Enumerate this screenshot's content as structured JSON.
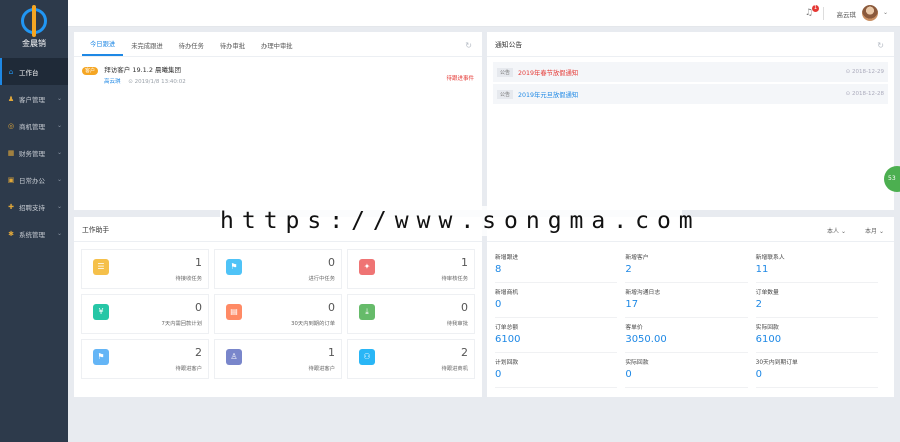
{
  "brand": {
    "name": "金晨销"
  },
  "sidebar": {
    "items": [
      {
        "label": "工作台",
        "active": true,
        "icon": "home-icon"
      },
      {
        "label": "客户管理",
        "icon": "users-icon"
      },
      {
        "label": "商机管理",
        "icon": "bulb-icon"
      },
      {
        "label": "财务管理",
        "icon": "finance-icon"
      },
      {
        "label": "日常办公",
        "icon": "briefcase-icon"
      },
      {
        "label": "招聘支持",
        "icon": "recruit-icon"
      },
      {
        "label": "系统管理",
        "icon": "gear-icon"
      }
    ]
  },
  "topbar": {
    "badge": "1",
    "username": "高云琪"
  },
  "tasks": {
    "tabs": [
      "今日跟进",
      "未完成跟进",
      "待办任务",
      "待办审批",
      "办理中审批"
    ],
    "item": {
      "tag": "客户",
      "title": "拜访客户 19.1.2 晨曦集团",
      "user": "高云琪",
      "time": "⊙ 2019/1/8 13:40:02",
      "status": "待跟进事件"
    }
  },
  "notices": {
    "title": "通知公告",
    "items": [
      {
        "tag": "公告",
        "title": "2019年春节放假通知",
        "date": "⊙ 2018-12-29",
        "color": "#e53935"
      },
      {
        "tag": "公告",
        "title": "2019年元旦放假通知",
        "date": "⊙ 2018-12-28",
        "color": "#1e88e5"
      }
    ]
  },
  "helper": {
    "title": "工作助手",
    "cards": [
      {
        "num": "1",
        "label": "待接收任务",
        "icon": "list-icon",
        "color": "#f5c04a",
        "glyph": "☰"
      },
      {
        "num": "0",
        "label": "进行中任务",
        "icon": "flag-icon",
        "color": "#4fc3f7",
        "glyph": "⚑"
      },
      {
        "num": "1",
        "label": "待审核任务",
        "icon": "pin-icon",
        "color": "#ef7474",
        "glyph": "✦"
      },
      {
        "num": "0",
        "label": "7天内需回款计划",
        "icon": "yen-icon",
        "color": "#26c6a6",
        "glyph": "¥"
      },
      {
        "num": "0",
        "label": "30天内到期的订单",
        "icon": "document-icon",
        "color": "#ff8a65",
        "glyph": "▤"
      },
      {
        "num": "0",
        "label": "待我审批",
        "icon": "approve-icon",
        "color": "#66bb6a",
        "glyph": "⤓"
      },
      {
        "num": "2",
        "label": "待跟进客户",
        "icon": "flag-blue-icon",
        "color": "#64b5f6",
        "glyph": "⚑"
      },
      {
        "num": "1",
        "label": "待跟进客户",
        "icon": "person-icon",
        "color": "#7986cb",
        "glyph": "♙"
      },
      {
        "num": "2",
        "label": "待跟进商机",
        "icon": "network-icon",
        "color": "#29b6f6",
        "glyph": "⚇"
      }
    ]
  },
  "stats": {
    "filter_person": "本人",
    "filter_period": "本月",
    "items": [
      {
        "label": "新增跟进",
        "value": "8"
      },
      {
        "label": "新增客户",
        "value": "2"
      },
      {
        "label": "新增联系人",
        "value": "11"
      },
      {
        "label": "新增商机",
        "value": "0"
      },
      {
        "label": "新增沟通日志",
        "value": "17"
      },
      {
        "label": "订单数量",
        "value": "2"
      },
      {
        "label": "订单总额",
        "value": "6100"
      },
      {
        "label": "客单价",
        "value": "3050.00"
      },
      {
        "label": "实际回款",
        "value": "6100"
      },
      {
        "label": "计划回款",
        "value": "0"
      },
      {
        "label": "实际回款",
        "value": "0"
      },
      {
        "label": "30天内到期订单",
        "value": "0"
      }
    ]
  },
  "watermark": "https://www.songma.com",
  "float_button": "53"
}
